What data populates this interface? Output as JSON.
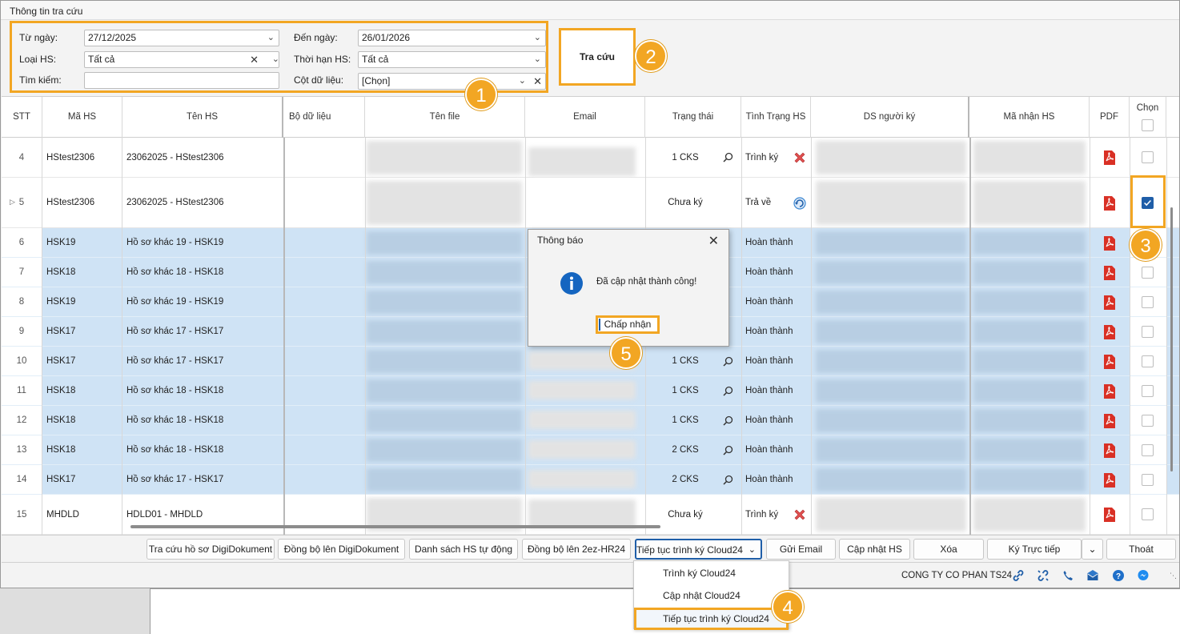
{
  "window": {
    "title": "Thông tin tra cứu"
  },
  "filter": {
    "from_label": "Từ ngày:",
    "from_value": "27/12/2025",
    "to_label": "Đến ngày:",
    "to_value": "26/01/2026",
    "type_label": "Loại HS:",
    "type_value": "Tất cả",
    "term_label": "Thời hạn HS:",
    "term_value": "Tất cả",
    "search_label": "Tìm kiếm:",
    "search_value": "",
    "column_label": "Cột dữ liệu:",
    "column_value": "[Chọn]"
  },
  "search_button": "Tra cứu",
  "badges": [
    "1",
    "2",
    "3",
    "4",
    "5"
  ],
  "columns": [
    "STT",
    "Mã HS",
    "Tên HS",
    "Bộ dữ liệu",
    "Tên file",
    "Email",
    "Trạng thái",
    "Tình Trạng HS",
    "DS người ký",
    "Mã nhận HS",
    "PDF",
    "Chọn"
  ],
  "rows": [
    {
      "stt": "4",
      "ma": "HStest2306",
      "ten": "23062025 - HStest2306",
      "trang_thai": "1 CKS",
      "tinh_trang": "Trình ký",
      "status_icon": "reject-icon",
      "selected": false,
      "checked": false
    },
    {
      "stt": "5",
      "ma": "HStest2306",
      "ten": "23062025 - HStest2306",
      "trang_thai": "Chưa ký",
      "tinh_trang": "Trả về",
      "status_icon": "return-icon",
      "selected": false,
      "checked": true
    },
    {
      "stt": "6",
      "ma": "HSK19",
      "ten": "Hồ sơ khác 19 - HSK19",
      "trang_thai": "",
      "tinh_trang": "Hoàn thành",
      "selected": true,
      "checked": false
    },
    {
      "stt": "7",
      "ma": "HSK18",
      "ten": "Hồ sơ khác 18 - HSK18",
      "trang_thai": "",
      "tinh_trang": "Hoàn thành",
      "selected": true,
      "checked": false
    },
    {
      "stt": "8",
      "ma": "HSK19",
      "ten": "Hồ sơ khác 19 - HSK19",
      "trang_thai": "",
      "tinh_trang": "Hoàn thành",
      "selected": true,
      "checked": false
    },
    {
      "stt": "9",
      "ma": "HSK17",
      "ten": "Hồ sơ khác 17 - HSK17",
      "trang_thai": "",
      "tinh_trang": "Hoàn thành",
      "selected": true,
      "checked": false
    },
    {
      "stt": "10",
      "ma": "HSK17",
      "ten": "Hồ sơ khác 17 - HSK17",
      "trang_thai": "1 CKS",
      "tinh_trang": "Hoàn thành",
      "selected": true,
      "checked": false
    },
    {
      "stt": "11",
      "ma": "HSK18",
      "ten": "Hồ sơ khác 18 - HSK18",
      "trang_thai": "1 CKS",
      "tinh_trang": "Hoàn thành",
      "selected": true,
      "checked": false
    },
    {
      "stt": "12",
      "ma": "HSK18",
      "ten": "Hồ sơ khác 18 - HSK18",
      "trang_thai": "1 CKS",
      "tinh_trang": "Hoàn thành",
      "selected": true,
      "checked": false
    },
    {
      "stt": "13",
      "ma": "HSK18",
      "ten": "Hồ sơ khác 18 - HSK18",
      "trang_thai": "2 CKS",
      "tinh_trang": "Hoàn thành",
      "selected": true,
      "checked": false
    },
    {
      "stt": "14",
      "ma": "HSK17",
      "ten": "Hồ sơ khác 17 - HSK17",
      "trang_thai": "2 CKS",
      "tinh_trang": "Hoàn thành",
      "selected": true,
      "checked": false
    },
    {
      "stt": "15",
      "ma": "MHDLD",
      "ten": "HDLD01 - MHDLD",
      "trang_thai": "Chưa ký",
      "tinh_trang": "Trình ký",
      "status_icon": "reject-icon",
      "selected": false,
      "checked": false
    }
  ],
  "toolbar": {
    "tra_cuu_digi": "Tra cứu hồ sơ DigiDokument",
    "dong_bo_digi": "Đồng bộ lên DigiDokument",
    "ds_tu_dong": "Danh sách HS tự động",
    "dong_bo_hr": "Đồng bộ lên 2ez-HR24",
    "tiep_tuc": "Tiếp tục trình ký Cloud24",
    "gui_email": "Gửi Email",
    "cap_nhat": "Cập nhật HS",
    "xoa": "Xóa",
    "ky_truc_tiep": "Ký Trực tiếp",
    "thoat": "Thoát"
  },
  "dropdown_menu": [
    "Trình ký Cloud24",
    "Cập nhật Cloud24",
    "Tiếp tục trình ký Cloud24"
  ],
  "status_bar": {
    "company": "CONG TY CO PHAN TS24"
  },
  "dialog": {
    "title": "Thông báo",
    "message": "Đã cập nhật thành công!",
    "ok": "Chấp nhận"
  },
  "colors": {
    "highlight": "#f2a623",
    "selected_row": "#cfe3f5",
    "accent": "#1f5ea8",
    "pdf_red": "#d93025"
  }
}
